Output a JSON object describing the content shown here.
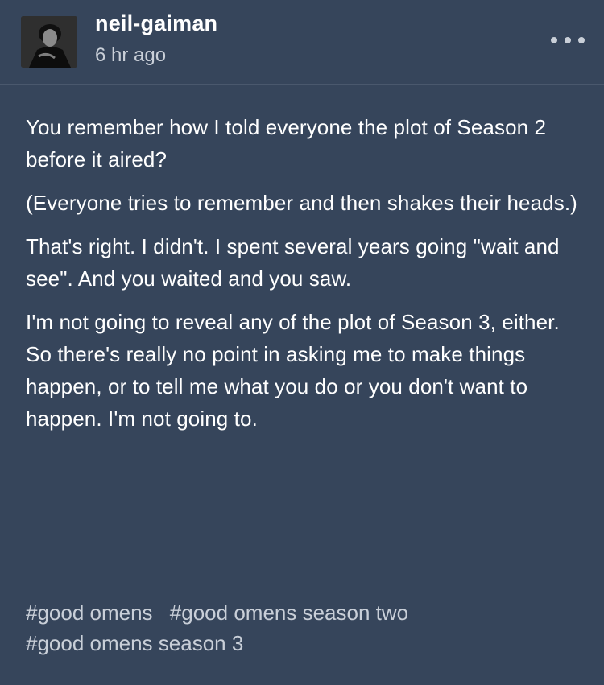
{
  "post": {
    "username": "neil-gaiman",
    "timestamp": "6 hr ago",
    "more_icon": "more-horizontal-icon",
    "paragraphs": [
      "You remember how I told everyone the plot of Season 2 before it aired?",
      "(Everyone tries to remember and then shakes their heads.)",
      "That's right. I didn't. I spent several years going \"wait and see\". And you waited and you saw.",
      "I'm not going to reveal any of the plot of Season 3, either. So there's really no point in asking me to make things happen, or to tell me what you do or you don't want to happen. I'm not going to."
    ],
    "tags": [
      "#good omens",
      "#good omens season two",
      "#good omens season 3"
    ]
  },
  "colors": {
    "background": "#36455b",
    "text": "#ffffff",
    "muted": "#c9cfd8"
  }
}
